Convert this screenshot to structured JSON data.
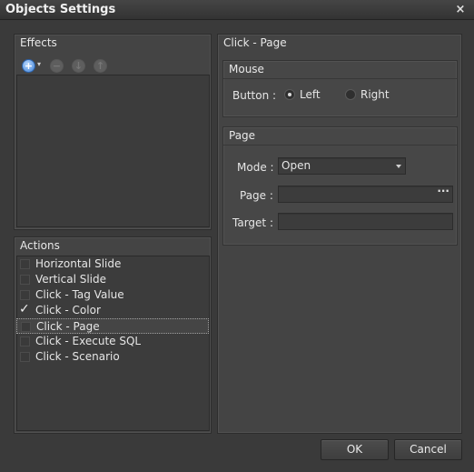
{
  "window": {
    "title": "Objects Settings",
    "close_glyph": "×"
  },
  "effects": {
    "title": "Effects",
    "toolbar": [
      {
        "name": "add-icon",
        "glyph": "+"
      },
      {
        "name": "remove-icon",
        "glyph": "−"
      },
      {
        "name": "move-down-icon",
        "glyph": "↓"
      },
      {
        "name": "move-up-icon",
        "glyph": "↑"
      }
    ],
    "caret": "▾"
  },
  "actions": {
    "title": "Actions",
    "items": [
      {
        "label": "Horizontal Slide",
        "checked": false,
        "selected": false
      },
      {
        "label": "Vertical Slide",
        "checked": false,
        "selected": false
      },
      {
        "label": "Click - Tag Value",
        "checked": false,
        "selected": false
      },
      {
        "label": "Click - Color",
        "checked": true,
        "selected": false
      },
      {
        "label": "Click - Page",
        "checked": false,
        "selected": true
      },
      {
        "label": "Click - Execute SQL",
        "checked": false,
        "selected": false
      },
      {
        "label": "Click - Scenario",
        "checked": false,
        "selected": false
      }
    ]
  },
  "detail": {
    "title": "Click - Page",
    "mouse": {
      "title": "Mouse",
      "button_label": "Button :",
      "options": [
        {
          "label": "Left",
          "selected": true
        },
        {
          "label": "Right",
          "selected": false
        }
      ]
    },
    "page": {
      "title": "Page",
      "mode_label": "Mode :",
      "mode_value": "Open",
      "page_label": "Page :",
      "page_value": "",
      "page_browse": "···",
      "target_label": "Target :",
      "target_value": ""
    }
  },
  "buttons": {
    "ok": "OK",
    "cancel": "Cancel"
  }
}
